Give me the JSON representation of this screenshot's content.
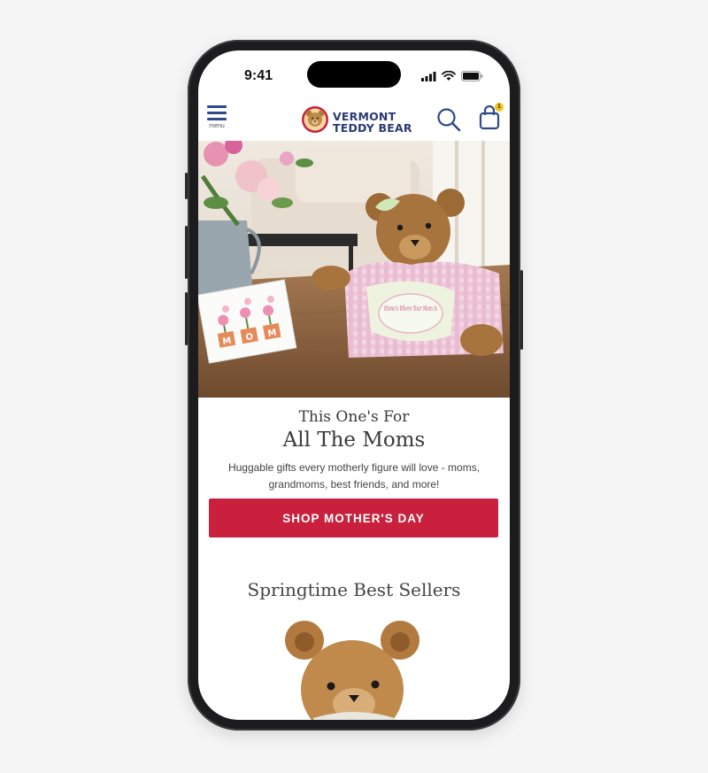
{
  "status_bar": {
    "time": "9:41",
    "icons": [
      "signal-icon",
      "wifi-icon",
      "battery-icon"
    ]
  },
  "header": {
    "menu_label": "menu",
    "logo_line1": "VERMONT",
    "logo_line2": "TEDDY BEAR",
    "cart_count": "1",
    "icons": [
      "hamburger-menu-icon",
      "bear-logo-icon",
      "search-icon",
      "shopping-bag-icon"
    ]
  },
  "hero": {
    "card_letters": [
      "M",
      "O",
      "M"
    ],
    "apron_text": "Home's Where Your Mom Is"
  },
  "promo": {
    "heading_line1": "This One's For",
    "heading_line2": "All The Moms",
    "body": "Huggable gifts every motherly figure will love - moms, grandmoms, best friends, and more!",
    "cta_label": "SHOP MOTHER'S DAY"
  },
  "best_sellers": {
    "heading": "Springtime Best Sellers"
  },
  "colors": {
    "brand_navy": "#2b3a73",
    "cta_red": "#c8203d",
    "badge_yellow": "#f5c518"
  }
}
